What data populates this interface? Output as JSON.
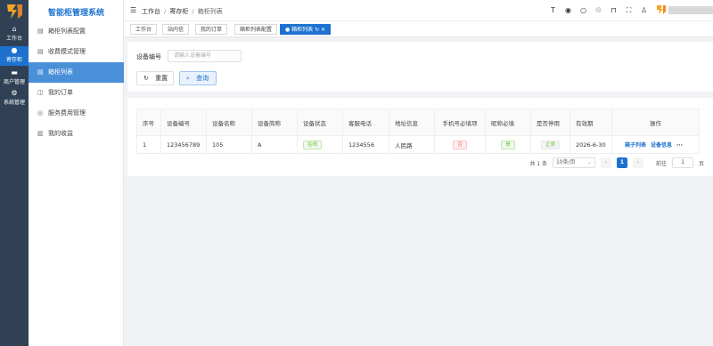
{
  "rail": {
    "items": [
      {
        "icon": "home-icon",
        "label": "工作台"
      },
      {
        "icon": "chat-icon",
        "label": "寄存柜"
      },
      {
        "icon": "card-icon",
        "label": "商户管理"
      },
      {
        "icon": "gear-icon",
        "label": "系统管理"
      }
    ]
  },
  "menu": {
    "title": "智能柜管理系统",
    "items": [
      {
        "icon": "cabinet-icon",
        "label": "箱柜列表配置"
      },
      {
        "icon": "cabinet-icon",
        "label": "收费模式管理"
      },
      {
        "icon": "cabinet-icon",
        "label": "箱柜列表"
      },
      {
        "icon": "order-icon",
        "label": "我的订单"
      },
      {
        "icon": "fee-icon",
        "label": "服务费用管理"
      },
      {
        "icon": "chart-icon",
        "label": "我的收益"
      }
    ]
  },
  "header": {
    "breadcrumb": [
      "工作台",
      "寄存柜",
      "箱柜列表"
    ]
  },
  "tags": [
    "工作台",
    "站内信",
    "我的订单",
    "箱柜列表配置",
    "箱柜列表"
  ],
  "search": {
    "label": "设备编号",
    "placeholder": "请输入设备编号",
    "reset_label": "重置",
    "query_label": "查询"
  },
  "table": {
    "columns": [
      "序号",
      "设备编号",
      "设备名称",
      "设备简称",
      "设备状态",
      "客服电话",
      "地址信息",
      "手机号必填项",
      "昵称必填",
      "是否停用",
      "有效期",
      "操作"
    ],
    "rows": [
      {
        "index": "1",
        "device_no": "123456789",
        "device_name": "105",
        "short_name": "A",
        "status": "在线",
        "phone": "1234556",
        "address": "人民路",
        "phone_required": "否",
        "nickname_required": "是",
        "disabled": "正常",
        "valid_until": "2026-6-30",
        "op_box": "箱子列表",
        "op_info": "设备信息",
        "op_more": "···"
      }
    ]
  },
  "pager": {
    "total": "共 1 条",
    "page_size": "10条/页",
    "current": "1",
    "goto_label": "前往",
    "goto_value": "1",
    "page_suffix": "页"
  },
  "colors": {
    "primary": "#1d72d0",
    "rail": "#304156",
    "active_menu": "#4a90d9"
  }
}
